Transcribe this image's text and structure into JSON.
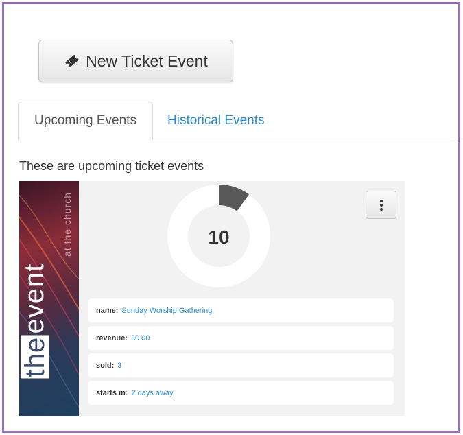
{
  "toolbar": {
    "new_event_label": "New Ticket Event",
    "new_event_icon": "ticket-icon"
  },
  "tabs": [
    {
      "label": "Upcoming Events",
      "active": true
    },
    {
      "label": "Historical Events",
      "active": false
    }
  ],
  "intro_text": "These are upcoming ticket events",
  "events": [
    {
      "poster": {
        "title_word_1": "the",
        "title_word_2": "event",
        "subtitle": "at the church"
      },
      "progress": {
        "value": "10",
        "fill_fraction": 0.1
      },
      "menu_icon": "vertical-ellipsis-icon",
      "details": [
        {
          "key": "name:",
          "value": "Sunday Worship Gathering"
        },
        {
          "key": "revenue:",
          "value": "£0.00"
        },
        {
          "key": "sold:",
          "value": "3"
        },
        {
          "key": "starts in:",
          "value": "2 days away"
        }
      ]
    }
  ],
  "colors": {
    "frame": "#9a6fc0",
    "link": "#2a8ac9",
    "donut_fill": "#595959",
    "donut_track": "#ffffff"
  }
}
